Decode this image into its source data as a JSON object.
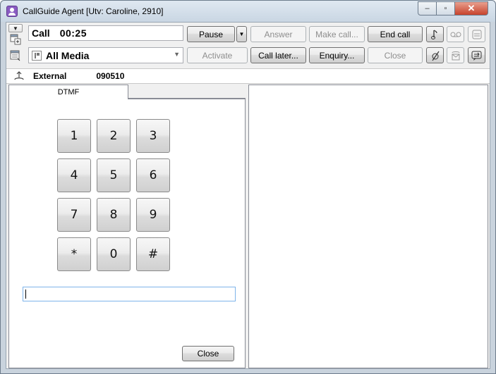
{
  "window": {
    "title": "CallGuide Agent [Utv: Caroline, 2910]",
    "minimize": "–",
    "maximize": "▫",
    "close": "✕"
  },
  "toolbar": {
    "status_label": "Call",
    "status_time": "00:25",
    "media_label": "All Media",
    "buttons": {
      "pause": "Pause",
      "answer": "Answer",
      "make_call": "Make call...",
      "end_call": "End call",
      "activate": "Activate",
      "call_later": "Call later...",
      "enquiry": "Enquiry...",
      "close": "Close"
    }
  },
  "contact": {
    "type": "External",
    "number": "090510"
  },
  "dtmf": {
    "tab_label": "DTMF",
    "keys": [
      "1",
      "2",
      "3",
      "4",
      "5",
      "6",
      "7",
      "8",
      "9",
      "*",
      "0",
      "#"
    ],
    "input_value": "",
    "close_label": "Close"
  },
  "colors": {
    "window_frame": "#c9d3dd",
    "close_red": "#c7432c",
    "input_focus": "#7eb4ea"
  }
}
